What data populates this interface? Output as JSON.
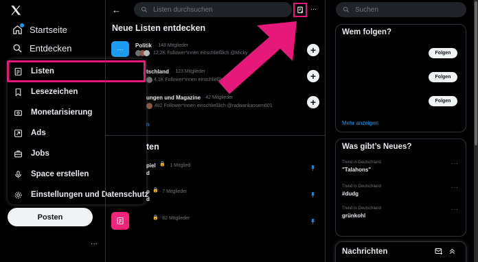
{
  "nav": {
    "home": "Startseite",
    "explore": "Entdecken"
  },
  "menu": {
    "items": [
      {
        "label": "Listen",
        "icon": "list-icon"
      },
      {
        "label": "Lesezeichen",
        "icon": "bookmark-icon"
      },
      {
        "label": "Monetarisierung",
        "icon": "money-icon"
      },
      {
        "label": "Ads",
        "icon": "ads-icon"
      },
      {
        "label": "Jobs",
        "icon": "briefcase-icon"
      },
      {
        "label": "Space erstellen",
        "icon": "microphone-icon"
      },
      {
        "label": "Einstellungen und Datenschutz",
        "icon": "gear-icon"
      }
    ]
  },
  "post_button": "Posten",
  "more_dots": "···",
  "center": {
    "search_placeholder": "Listen durchsuchen",
    "discover_title": "Neue Listen entdecken",
    "discover": [
      {
        "title": "Politik",
        "members": "· 148 Mitglieder",
        "followers": "12,2K Follower*innen einschließlich @Micky"
      },
      {
        "title": "tschland",
        "members": "· 123 Mitglieder",
        "followers": "4,1K Follower*innen einschließlich"
      },
      {
        "title": "ungen und Magazine",
        "members": "· 42 Mitglieder",
        "followers": "482 Follower*innen einschließlich @radwankassem601"
      }
    ],
    "more_fragment": "n",
    "your_lists_title": "ten",
    "your_lists": [
      {
        "title": "piel",
        "lock": "🔒",
        "members": "· 1 Mitglied",
        "sub": "d"
      },
      {
        "title": "o",
        "lock": "🔒",
        "members": "· 7 Mitglieder",
        "sub": "d"
      },
      {
        "title": "",
        "lock": "🔒",
        "members": "· 82 Mitglieder",
        "sub": ""
      }
    ],
    "back_arrow": "←",
    "new_list_icon": "new-list-icon",
    "menu_dots": "···",
    "plus": "+"
  },
  "right": {
    "search_placeholder": "Suchen",
    "who_to_follow_title": "Wem folgen?",
    "follow_label": "Folgen",
    "show_more": "Mehr anzeigen",
    "whats_new_title": "Was gibt’s Neues?",
    "trends": [
      {
        "category": "Trend in Deutschland",
        "name": "\"Talahons\""
      },
      {
        "category": "Trend in Deutschland",
        "name": "#dudg"
      },
      {
        "category": "Trend in Deutschland",
        "name": "grünkohl"
      }
    ],
    "messages_title": "Nachrichten"
  },
  "colors": {
    "accent": "#1d9bf0",
    "highlight": "#e6197a",
    "background": "#000000"
  }
}
